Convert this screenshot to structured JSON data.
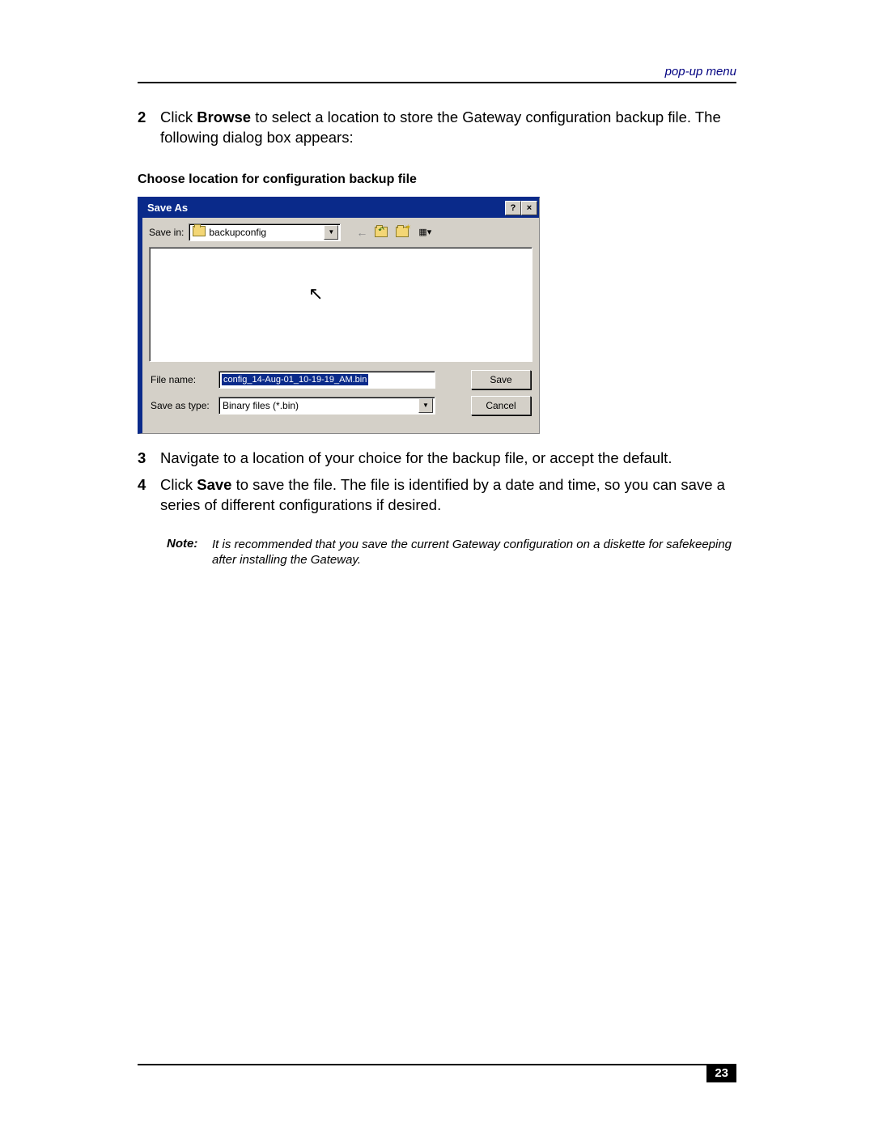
{
  "header": {
    "section_label": "pop-up menu"
  },
  "steps": {
    "s2": {
      "num": "2",
      "text_before": "Click ",
      "bold": "Browse",
      "text_after": " to select a location to store the Gateway configuration backup file. The following dialog box appears:"
    },
    "s3": {
      "num": "3",
      "text": "Navigate to a location of your choice for the backup file, or accept the default."
    },
    "s4": {
      "num": "4",
      "text_before": "Click ",
      "bold": "Save",
      "text_after": " to save the file. The file is identified by a date and time, so you can save a series of different configurations if desired."
    }
  },
  "subheading": "Choose location for configuration backup file",
  "dialog": {
    "title": "Save As",
    "help_btn": "?",
    "close_btn": "×",
    "save_in_label": "Save in:",
    "save_in_value": "backupconfig",
    "file_name_label": "File name:",
    "file_name_value": "config_14-Aug-01_10-19-19_AM.bin",
    "save_type_label": "Save as type:",
    "save_type_value": "Binary files (*.bin)",
    "save_btn": "Save",
    "cancel_btn": "Cancel"
  },
  "note": {
    "label": "Note:",
    "text": "It is recommended that you save the current Gateway configuration on a diskette for safekeeping after installing the Gateway."
  },
  "footer": {
    "page_num": "23"
  }
}
